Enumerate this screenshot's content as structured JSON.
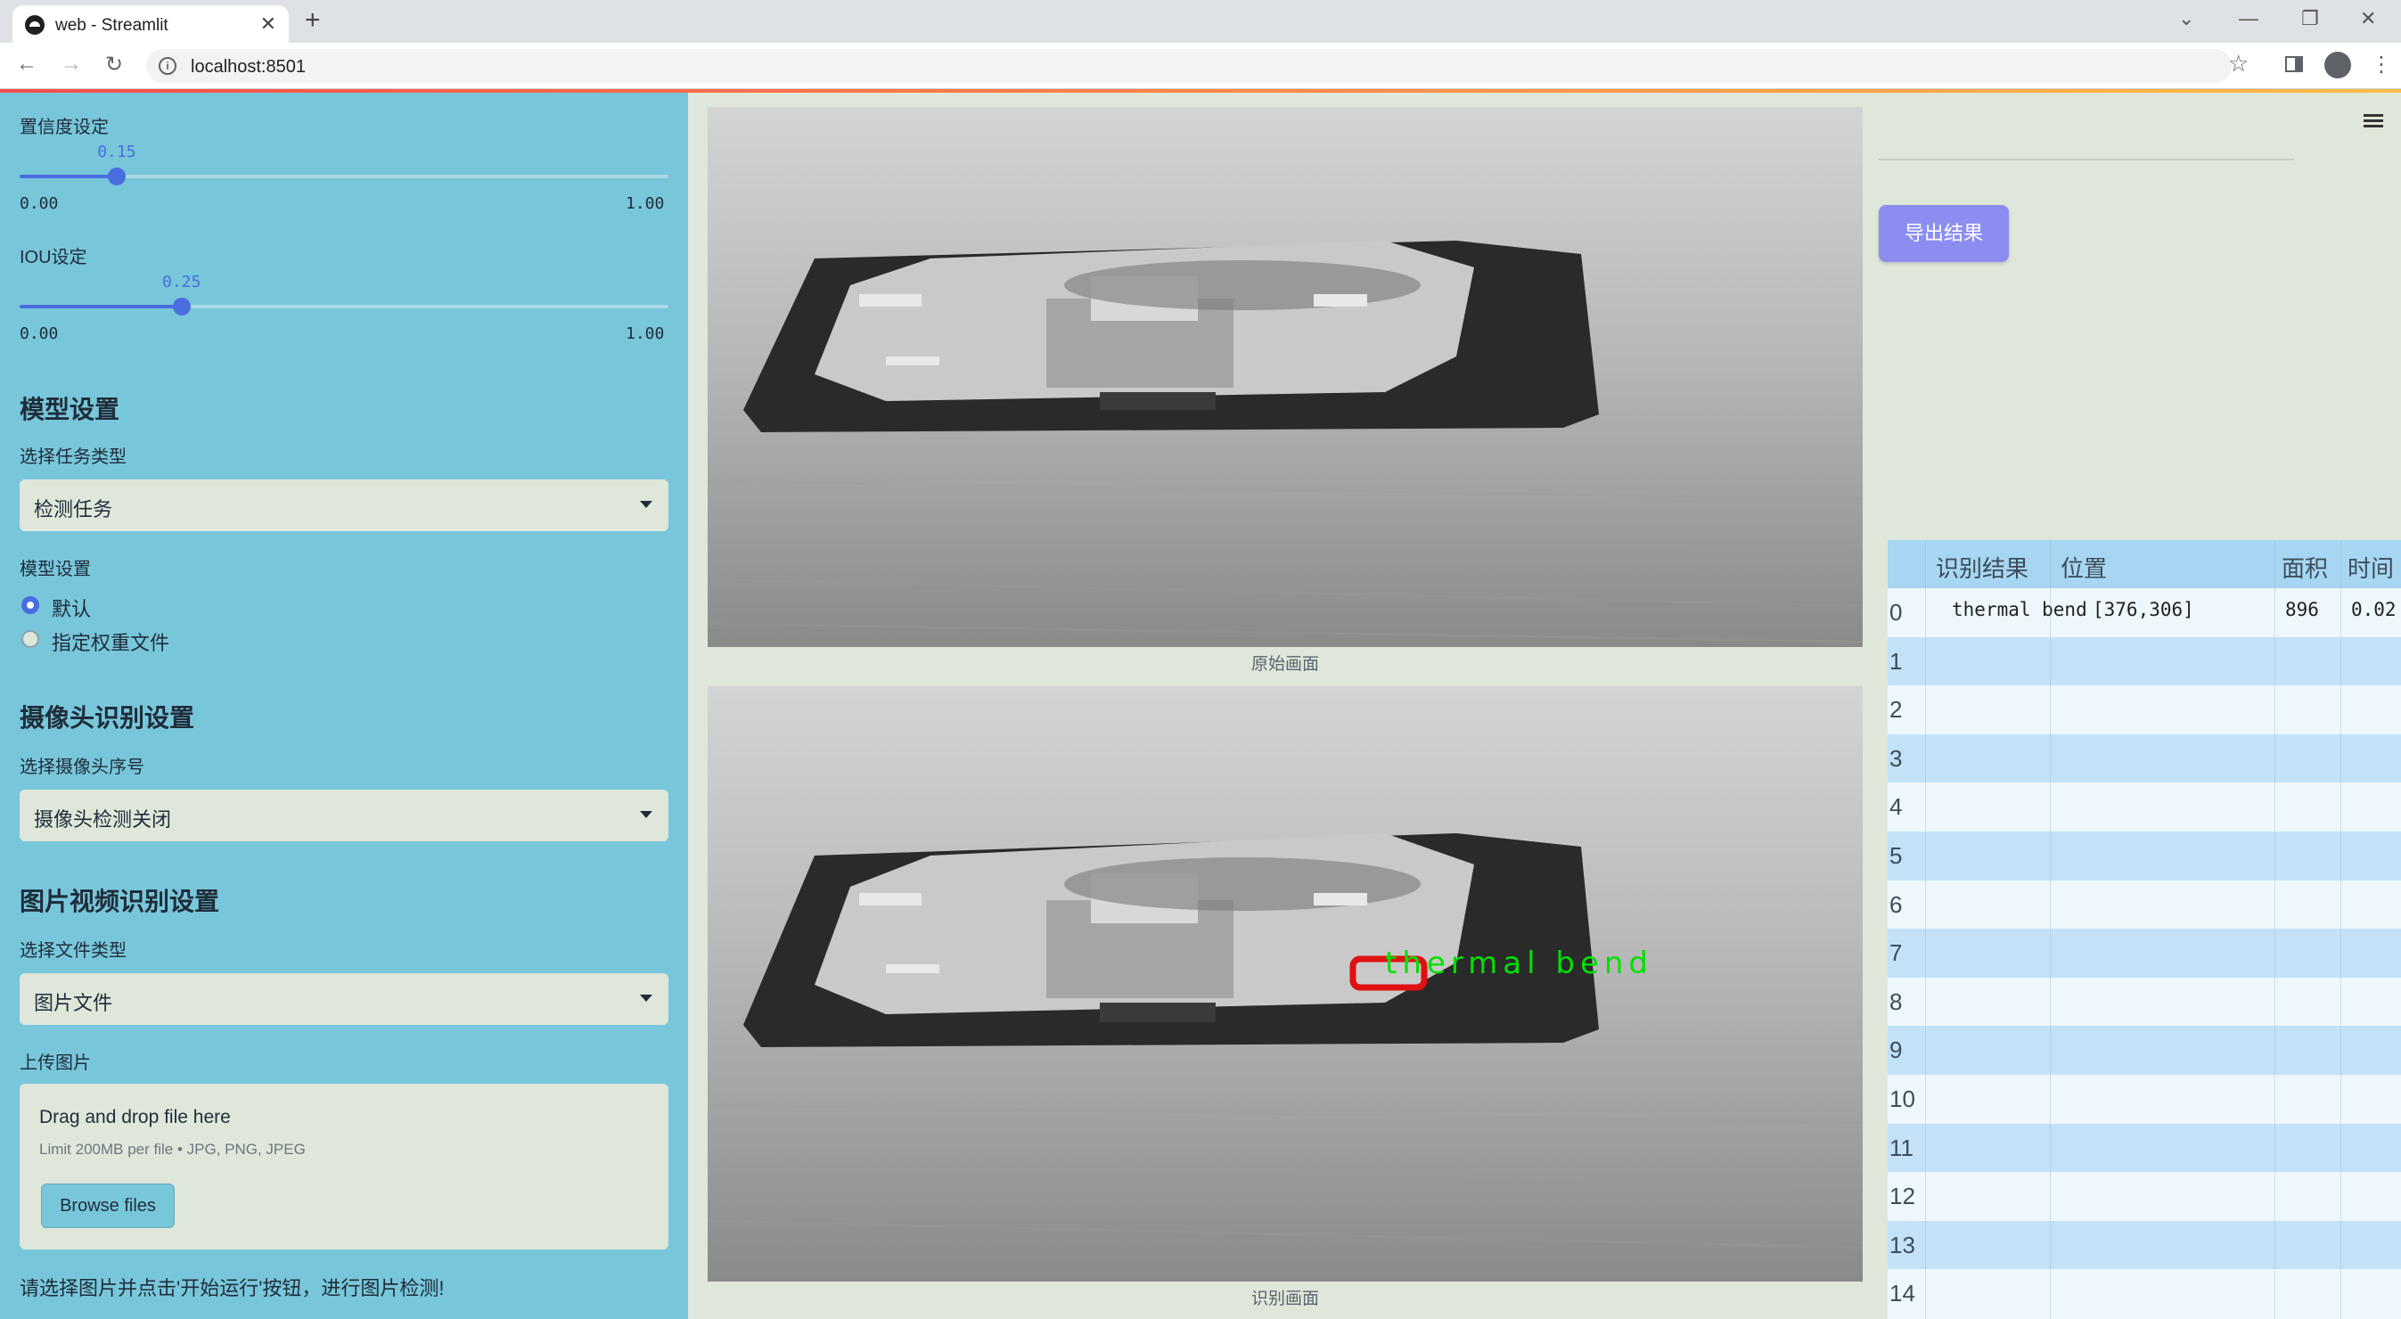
{
  "browser": {
    "tab_title": "web - Streamlit",
    "url": "localhost:8501"
  },
  "sidebar": {
    "confidence": {
      "label": "置信度设定",
      "value": "0.15",
      "min": "0.00",
      "max": "1.00",
      "fraction": 0.15
    },
    "iou": {
      "label": "IOU设定",
      "value": "0.25",
      "min": "0.00",
      "max": "1.00",
      "fraction": 0.25
    },
    "model_heading": "模型设置",
    "task_label": "选择任务类型",
    "task_value": "检测任务",
    "model_label": "模型设置",
    "model_options": [
      "默认",
      "指定权重文件"
    ],
    "model_selected": 0,
    "camera_heading": "摄像头识别设置",
    "camera_label": "选择摄像头序号",
    "camera_value": "摄像头检测关闭",
    "media_heading": "图片视频识别设置",
    "filetype_label": "选择文件类型",
    "filetype_value": "图片文件",
    "upload_label": "上传图片",
    "upload_drop": "Drag and drop file here",
    "upload_limit": "Limit 200MB per file • JPG, PNG, JPEG",
    "browse_label": "Browse files",
    "note": "请选择图片并点击'开始运行'按钮，进行图片检测!"
  },
  "main": {
    "original_caption": "原始画面",
    "detected_caption": "识别画面",
    "detection_label": "thermal bend"
  },
  "right": {
    "export_label": "导出结果",
    "table": {
      "headers": [
        "识别结果",
        "位置",
        "面积",
        "时间"
      ],
      "rows": [
        {
          "index": "0",
          "result": "thermal bend",
          "position": "[376,306]",
          "area": "896",
          "time": "0.02"
        },
        {
          "index": "1"
        },
        {
          "index": "2"
        },
        {
          "index": "3"
        },
        {
          "index": "4"
        },
        {
          "index": "5"
        },
        {
          "index": "6"
        },
        {
          "index": "7"
        },
        {
          "index": "8"
        },
        {
          "index": "9"
        },
        {
          "index": "10"
        },
        {
          "index": "11"
        },
        {
          "index": "12"
        },
        {
          "index": "13"
        },
        {
          "index": "14"
        }
      ]
    }
  },
  "colors": {
    "sidebar_bg": "#78c6da",
    "main_bg": "#dfe7da",
    "accent": "#4a6de0",
    "export_button": "#8b8ef0",
    "detection_box": "#e01010",
    "detection_text": "#00e000"
  }
}
